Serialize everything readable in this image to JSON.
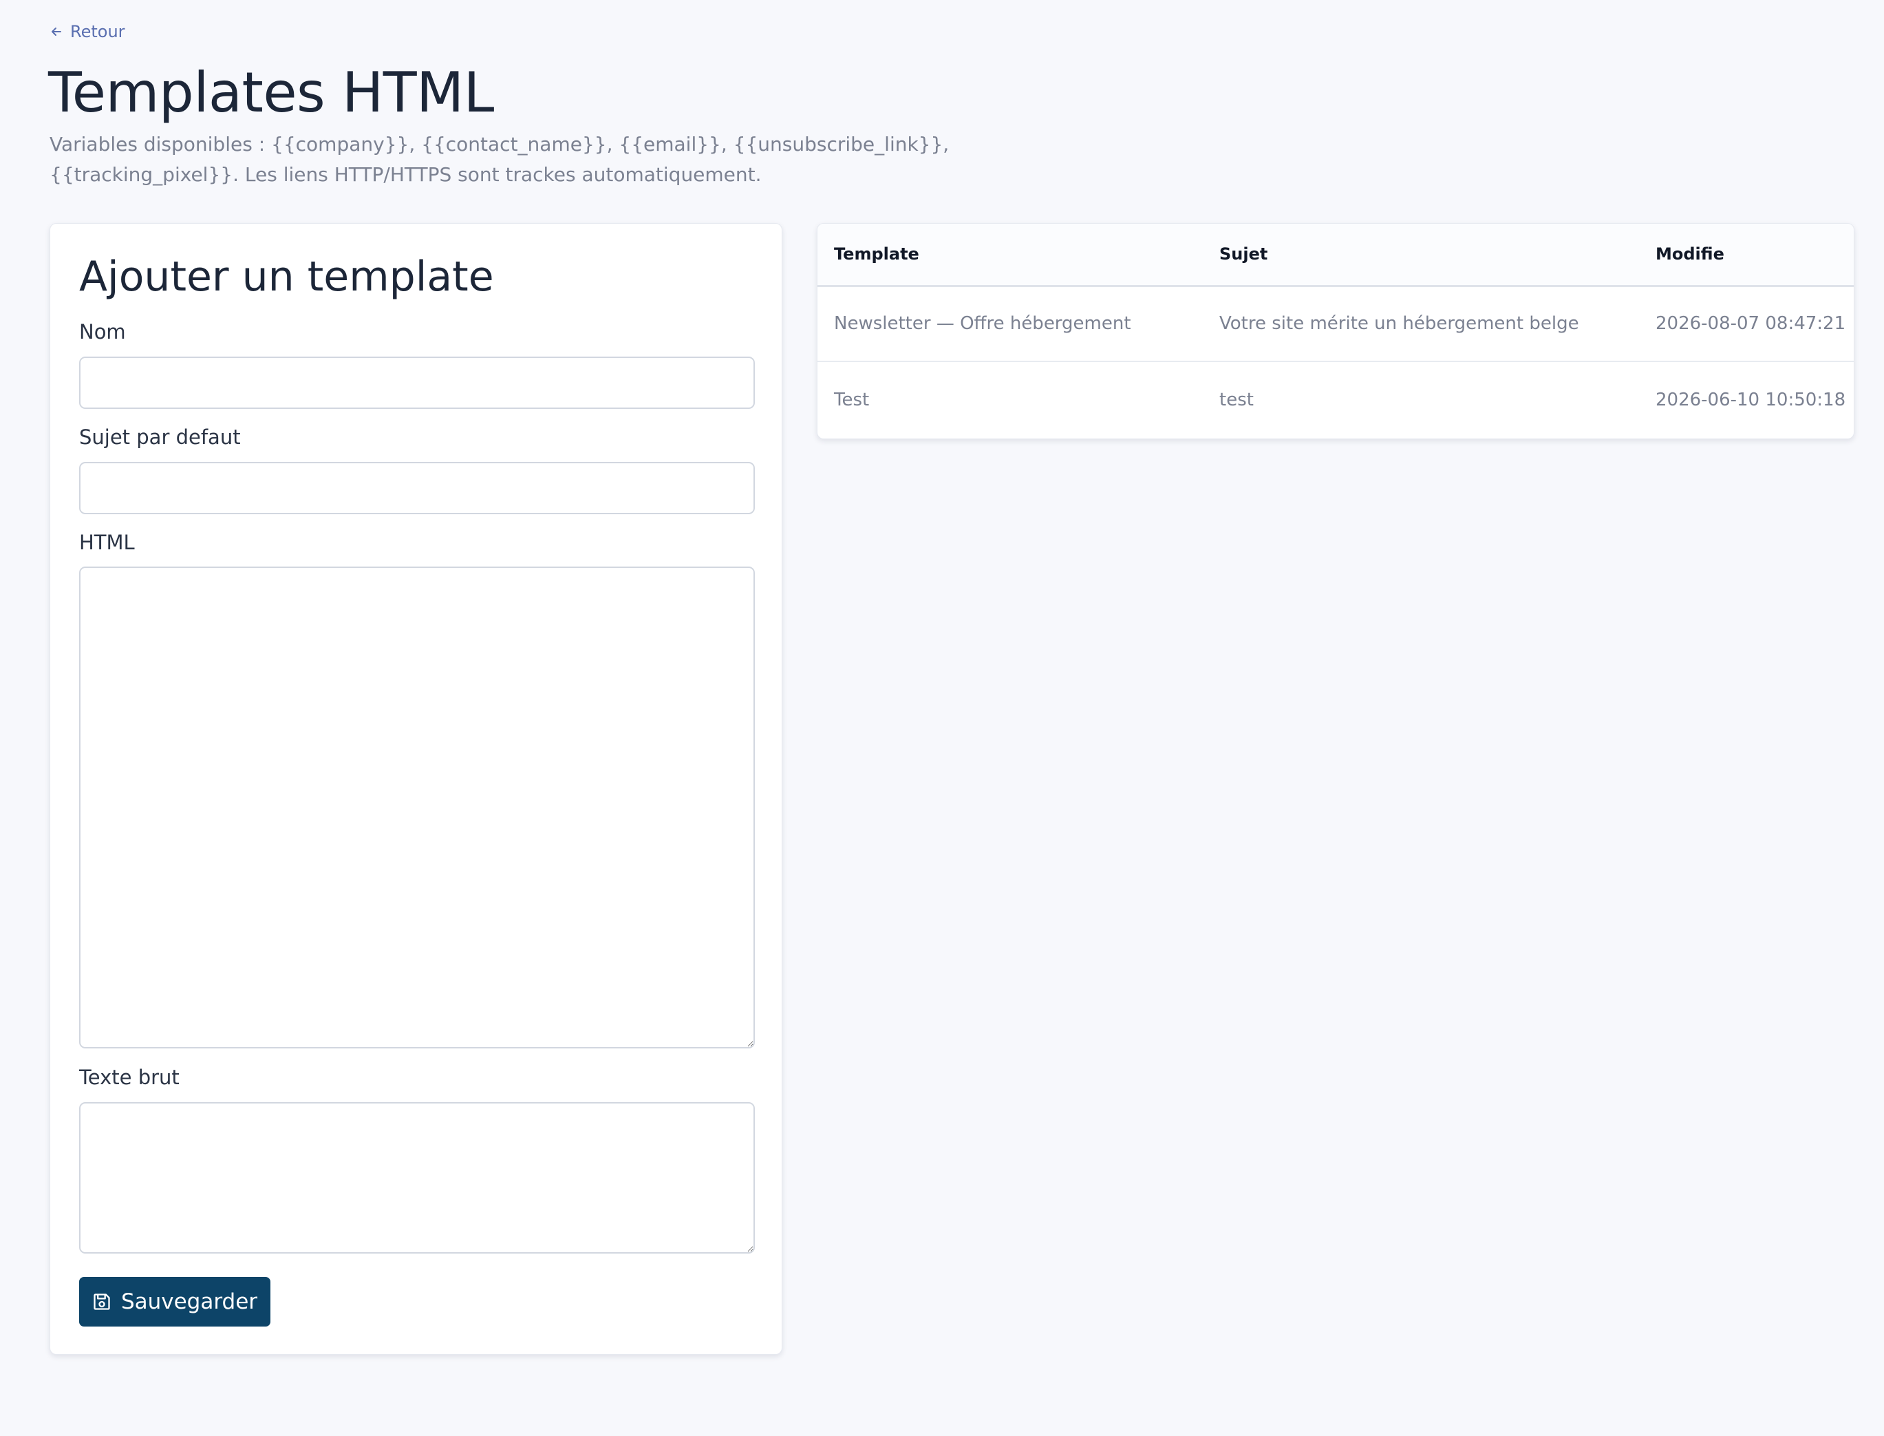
{
  "nav": {
    "back_label": "Retour"
  },
  "header": {
    "title": "Templates HTML",
    "subtitle": "Variables disponibles : {{company}}, {{contact_name}}, {{email}}, {{unsubscribe_link}}, {{tracking_pixel}}. Les liens HTTP/HTTPS sont trackes automatiquement."
  },
  "form": {
    "heading": "Ajouter un template",
    "name_label": "Nom",
    "name_value": "",
    "subject_label": "Sujet par defaut",
    "subject_value": "",
    "html_label": "HTML",
    "html_value": "",
    "text_label": "Texte brut",
    "text_value": "",
    "save_label": "Sauvegarder",
    "save_icon": "floppy-disk-icon",
    "button_color": "#0d4468"
  },
  "table": {
    "columns": [
      "Template",
      "Sujet",
      "Modifie"
    ],
    "rows": [
      {
        "template": "Newsletter — Offre hébergement",
        "subject": "Votre site mérite un hébergement belge",
        "modified": "2026-08-07 08:47:21"
      },
      {
        "template": "Test",
        "subject": "test",
        "modified": "2026-06-10 10:50:18"
      }
    ]
  },
  "colors": {
    "background": "#f7f8fc",
    "link": "#5a6fb0",
    "muted_text": "#7b8191",
    "primary_button": "#0d4468"
  }
}
